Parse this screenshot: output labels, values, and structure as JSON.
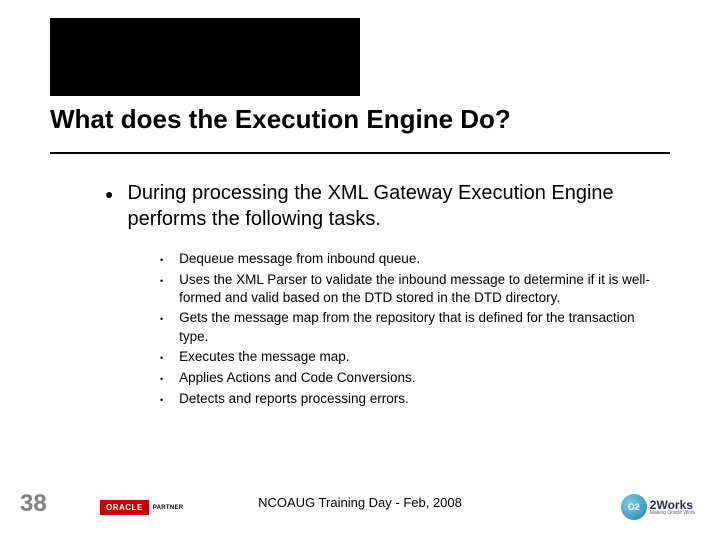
{
  "title": "What does the Execution Engine Do?",
  "main_bullet": "During processing the XML Gateway Execution Engine performs the following tasks.",
  "sub_bullets": [
    "Dequeue message from inbound queue.",
    "Uses the XML Parser to validate the inbound message to determine if it is well-formed and valid based on the DTD stored in the DTD directory.",
    "Gets the message map from the repository that is defined for the transaction type.",
    "Executes the message map.",
    "Applies Actions and Code Conversions.",
    "Detects and reports processing errors."
  ],
  "slide_number": "38",
  "footer": "NCOAUG Training Day - Feb, 2008",
  "oracle": {
    "brand": "ORACLE",
    "partner": "PARTNER"
  },
  "o2works": {
    "circle": "O2",
    "name": "2Works",
    "tagline": "Making Oracle Work"
  }
}
